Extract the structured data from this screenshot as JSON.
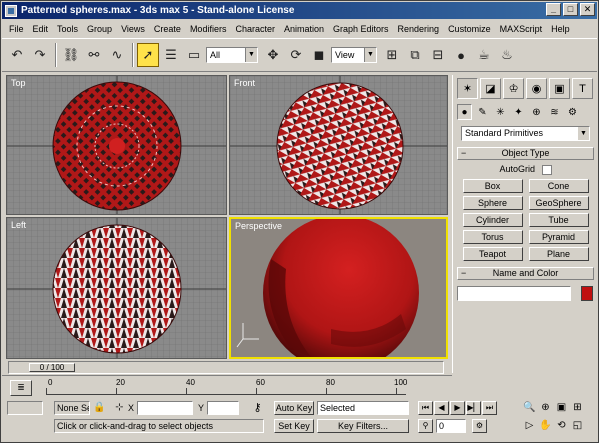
{
  "window": {
    "title": "Patterned spheres.max - 3ds max 5 - Stand-alone License",
    "min": "_",
    "max": "□",
    "close": "✕"
  },
  "menu": [
    "File",
    "Edit",
    "Tools",
    "Group",
    "Views",
    "Create",
    "Modifiers",
    "Character",
    "Animation",
    "Graph Editors",
    "Rendering",
    "Customize",
    "MAXScript",
    "Help"
  ],
  "toolbar": {
    "selection_filter": "All",
    "refcoord": "View"
  },
  "viewports": {
    "top": "Top",
    "front": "Front",
    "left": "Left",
    "perspective": "Perspective"
  },
  "command_panel": {
    "category": "Standard Primitives",
    "object_type_header": "Object Type",
    "autogrid_label": "AutoGrid",
    "objects": [
      "Box",
      "Cone",
      "Sphere",
      "GeoSphere",
      "Cylinder",
      "Tube",
      "Torus",
      "Pyramid",
      "Teapot",
      "Plane"
    ],
    "name_color_header": "Name and Color",
    "color": "#c01010"
  },
  "time": {
    "slider_label": "0 / 100",
    "ticks": [
      "0",
      "20",
      "40",
      "60",
      "80",
      "100"
    ]
  },
  "status": {
    "selection": "None Se",
    "x_label": "X",
    "y_label": "Y",
    "auto_key": "Auto Key",
    "set_key": "Set Key",
    "selected_filter": "Selected",
    "key_filters": "Key Filters...",
    "prompt": "Click or click-and-drag to select objects",
    "frame": "0"
  }
}
